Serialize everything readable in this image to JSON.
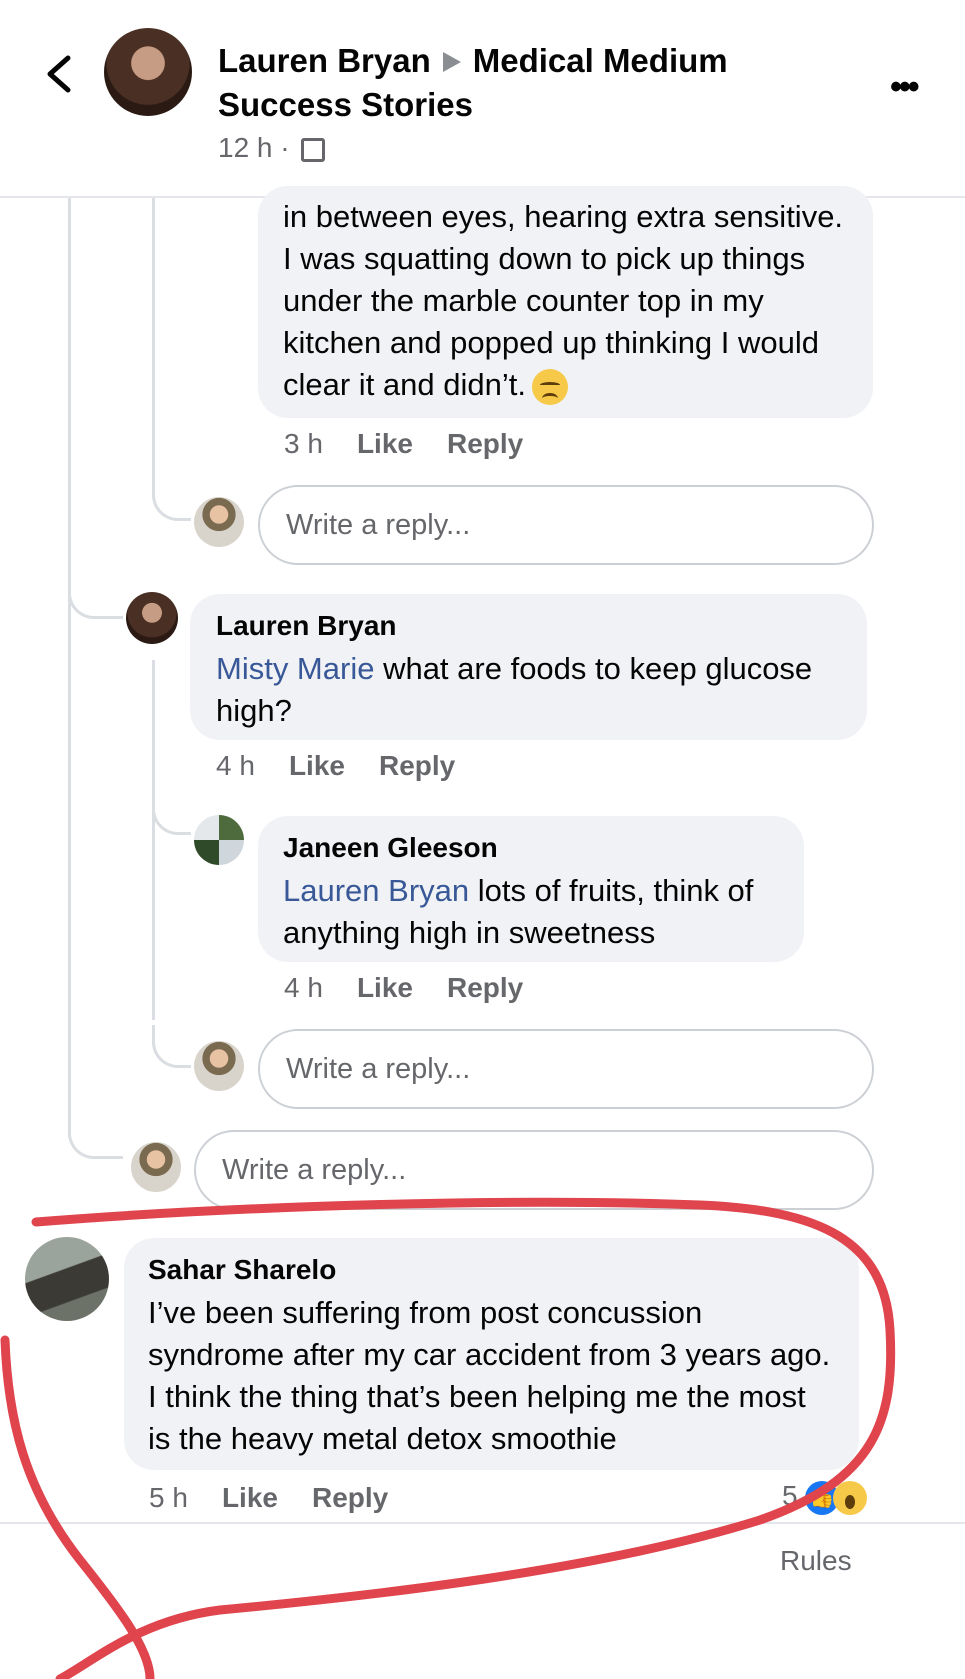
{
  "header": {
    "author": "Lauren Bryan",
    "group_line1": "Medical Medium",
    "group_line2": "Success Stories",
    "time": "12 h",
    "separator": "·"
  },
  "comments": [
    {
      "text": "in between eyes, hearing extra sensitive. I was squatting down to pick up things under the marble counter top in my kitchen and popped up thinking I would clear it and didn’t.",
      "time": "3 h",
      "like": "Like",
      "reply": "Reply"
    },
    {
      "name": "Lauren Bryan",
      "mention": "Misty Marie",
      "text": " what are foods to keep glucose high?",
      "time": "4 h",
      "like": "Like",
      "reply": "Reply"
    },
    {
      "name": "Janeen Gleeson",
      "mention": "Lauren Bryan",
      "text": " lots of fruits, think of anything high in sweetness",
      "time": "4 h",
      "like": "Like",
      "reply": "Reply"
    },
    {
      "name": "Sahar Sharelo",
      "text": "I’ve been suffering from post concussion syndrome after my car accident from 3 years ago. I think the thing that’s been helping me the most is the heavy metal detox smoothie",
      "time": "5 h",
      "like": "Like",
      "reply": "Reply",
      "reaction_count": "5"
    }
  ],
  "reply_placeholder": "Write a reply...",
  "footer": {
    "rules": "Rules"
  },
  "colors": {
    "mention": "#385898",
    "annotation": "#e0444d"
  }
}
